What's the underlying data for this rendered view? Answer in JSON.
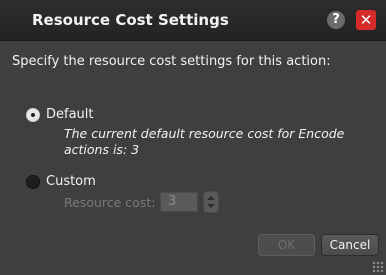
{
  "window": {
    "title": "Resource Cost Settings",
    "help_glyph": "?",
    "close_glyph": "✕"
  },
  "prompt": "Specify the resource cost settings for this action:",
  "options": {
    "default_label": "Default",
    "default_selected": true,
    "note_line1": "The current default resource cost for Encode",
    "note_line2": "actions is: 3",
    "custom_label": "Custom",
    "custom_selected": false
  },
  "resource_cost": {
    "label": "Resource cost:",
    "value": "3",
    "enabled": false
  },
  "buttons": {
    "ok_label": "OK",
    "ok_enabled": false,
    "cancel_label": "Cancel"
  },
  "icons": {
    "help": "help-icon",
    "close": "close-icon",
    "spinner": "spinner-icon",
    "resize": "resize-grip-icon"
  },
  "colors": {
    "background": "#3f3f3f",
    "titlebar": "#232323",
    "close_button": "#d62b2b",
    "disabled_text": "#7a7a7a"
  }
}
